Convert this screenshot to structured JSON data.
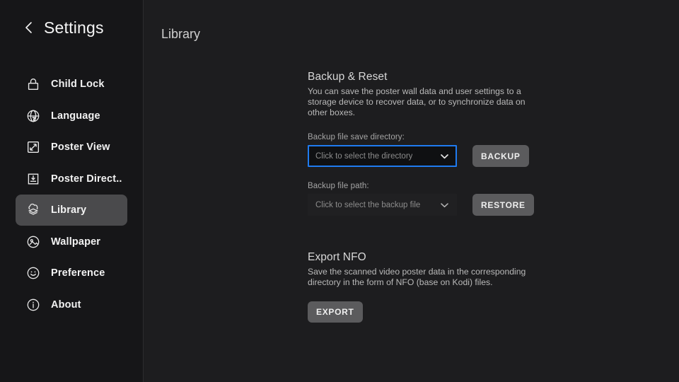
{
  "sidebar": {
    "back_icon": "chevron-left-icon",
    "title": "Settings",
    "items": [
      {
        "label": "Child Lock",
        "icon": "lock-icon",
        "selected": false
      },
      {
        "label": "Language",
        "icon": "globe-icon",
        "selected": false
      },
      {
        "label": "Poster View",
        "icon": "expand-icon",
        "selected": false
      },
      {
        "label": "Poster Direct..",
        "icon": "save-inbox-icon",
        "selected": false
      },
      {
        "label": "Library",
        "icon": "layers-icon",
        "selected": true
      },
      {
        "label": "Wallpaper",
        "icon": "image-circle-icon",
        "selected": false
      },
      {
        "label": "Preference",
        "icon": "smiley-icon",
        "selected": false
      },
      {
        "label": "About",
        "icon": "info-icon",
        "selected": false
      }
    ]
  },
  "main": {
    "page_title": "Library",
    "backup_section": {
      "title": "Backup & Reset",
      "description": "You can save the poster wall data and user settings to a storage device to recover data, or to synchronize data on other boxes.",
      "save_directory": {
        "label": "Backup file save directory:",
        "placeholder": "Click to select the directory",
        "value": "",
        "focused": true,
        "caret_icon": "chevron-down-icon"
      },
      "backup_button": "BACKUP",
      "file_path": {
        "label": "Backup file path:",
        "placeholder": "Click to select the backup file",
        "value": "",
        "focused": false,
        "caret_icon": "chevron-down-icon"
      },
      "restore_button": "RESTORE"
    },
    "export_section": {
      "title": "Export NFO",
      "description": "Save the scanned video poster data in the corresponding directory in the form of NFO (base on Kodi) files.",
      "export_button": "EXPORT"
    }
  },
  "colors": {
    "focus_blue": "#1f7bf0",
    "sidebar_bg": "#161618",
    "content_bg": "#1d1d1f",
    "selected_item_bg": "#4a4a4c",
    "button_bg": "#5b5b5d"
  }
}
